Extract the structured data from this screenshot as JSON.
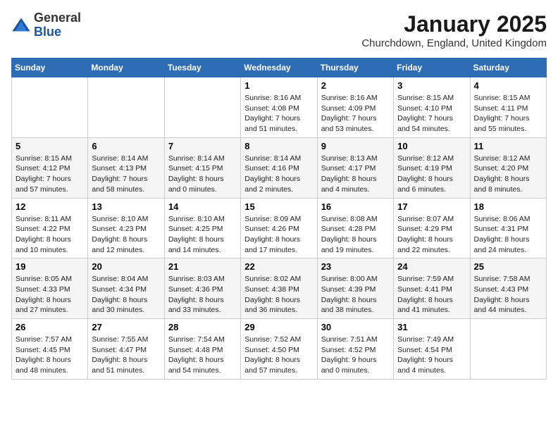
{
  "logo": {
    "general": "General",
    "blue": "Blue"
  },
  "header": {
    "month": "January 2025",
    "location": "Churchdown, England, United Kingdom"
  },
  "days_of_week": [
    "Sunday",
    "Monday",
    "Tuesday",
    "Wednesday",
    "Thursday",
    "Friday",
    "Saturday"
  ],
  "weeks": [
    [
      {
        "day": "",
        "info": ""
      },
      {
        "day": "",
        "info": ""
      },
      {
        "day": "",
        "info": ""
      },
      {
        "day": "1",
        "info": "Sunrise: 8:16 AM\nSunset: 4:08 PM\nDaylight: 7 hours\nand 51 minutes."
      },
      {
        "day": "2",
        "info": "Sunrise: 8:16 AM\nSunset: 4:09 PM\nDaylight: 7 hours\nand 53 minutes."
      },
      {
        "day": "3",
        "info": "Sunrise: 8:15 AM\nSunset: 4:10 PM\nDaylight: 7 hours\nand 54 minutes."
      },
      {
        "day": "4",
        "info": "Sunrise: 8:15 AM\nSunset: 4:11 PM\nDaylight: 7 hours\nand 55 minutes."
      }
    ],
    [
      {
        "day": "5",
        "info": "Sunrise: 8:15 AM\nSunset: 4:12 PM\nDaylight: 7 hours\nand 57 minutes."
      },
      {
        "day": "6",
        "info": "Sunrise: 8:14 AM\nSunset: 4:13 PM\nDaylight: 7 hours\nand 58 minutes."
      },
      {
        "day": "7",
        "info": "Sunrise: 8:14 AM\nSunset: 4:15 PM\nDaylight: 8 hours\nand 0 minutes."
      },
      {
        "day": "8",
        "info": "Sunrise: 8:14 AM\nSunset: 4:16 PM\nDaylight: 8 hours\nand 2 minutes."
      },
      {
        "day": "9",
        "info": "Sunrise: 8:13 AM\nSunset: 4:17 PM\nDaylight: 8 hours\nand 4 minutes."
      },
      {
        "day": "10",
        "info": "Sunrise: 8:12 AM\nSunset: 4:19 PM\nDaylight: 8 hours\nand 6 minutes."
      },
      {
        "day": "11",
        "info": "Sunrise: 8:12 AM\nSunset: 4:20 PM\nDaylight: 8 hours\nand 8 minutes."
      }
    ],
    [
      {
        "day": "12",
        "info": "Sunrise: 8:11 AM\nSunset: 4:22 PM\nDaylight: 8 hours\nand 10 minutes."
      },
      {
        "day": "13",
        "info": "Sunrise: 8:10 AM\nSunset: 4:23 PM\nDaylight: 8 hours\nand 12 minutes."
      },
      {
        "day": "14",
        "info": "Sunrise: 8:10 AM\nSunset: 4:25 PM\nDaylight: 8 hours\nand 14 minutes."
      },
      {
        "day": "15",
        "info": "Sunrise: 8:09 AM\nSunset: 4:26 PM\nDaylight: 8 hours\nand 17 minutes."
      },
      {
        "day": "16",
        "info": "Sunrise: 8:08 AM\nSunset: 4:28 PM\nDaylight: 8 hours\nand 19 minutes."
      },
      {
        "day": "17",
        "info": "Sunrise: 8:07 AM\nSunset: 4:29 PM\nDaylight: 8 hours\nand 22 minutes."
      },
      {
        "day": "18",
        "info": "Sunrise: 8:06 AM\nSunset: 4:31 PM\nDaylight: 8 hours\nand 24 minutes."
      }
    ],
    [
      {
        "day": "19",
        "info": "Sunrise: 8:05 AM\nSunset: 4:33 PM\nDaylight: 8 hours\nand 27 minutes."
      },
      {
        "day": "20",
        "info": "Sunrise: 8:04 AM\nSunset: 4:34 PM\nDaylight: 8 hours\nand 30 minutes."
      },
      {
        "day": "21",
        "info": "Sunrise: 8:03 AM\nSunset: 4:36 PM\nDaylight: 8 hours\nand 33 minutes."
      },
      {
        "day": "22",
        "info": "Sunrise: 8:02 AM\nSunset: 4:38 PM\nDaylight: 8 hours\nand 36 minutes."
      },
      {
        "day": "23",
        "info": "Sunrise: 8:00 AM\nSunset: 4:39 PM\nDaylight: 8 hours\nand 38 minutes."
      },
      {
        "day": "24",
        "info": "Sunrise: 7:59 AM\nSunset: 4:41 PM\nDaylight: 8 hours\nand 41 minutes."
      },
      {
        "day": "25",
        "info": "Sunrise: 7:58 AM\nSunset: 4:43 PM\nDaylight: 8 hours\nand 44 minutes."
      }
    ],
    [
      {
        "day": "26",
        "info": "Sunrise: 7:57 AM\nSunset: 4:45 PM\nDaylight: 8 hours\nand 48 minutes."
      },
      {
        "day": "27",
        "info": "Sunrise: 7:55 AM\nSunset: 4:47 PM\nDaylight: 8 hours\nand 51 minutes."
      },
      {
        "day": "28",
        "info": "Sunrise: 7:54 AM\nSunset: 4:48 PM\nDaylight: 8 hours\nand 54 minutes."
      },
      {
        "day": "29",
        "info": "Sunrise: 7:52 AM\nSunset: 4:50 PM\nDaylight: 8 hours\nand 57 minutes."
      },
      {
        "day": "30",
        "info": "Sunrise: 7:51 AM\nSunset: 4:52 PM\nDaylight: 9 hours\nand 0 minutes."
      },
      {
        "day": "31",
        "info": "Sunrise: 7:49 AM\nSunset: 4:54 PM\nDaylight: 9 hours\nand 4 minutes."
      },
      {
        "day": "",
        "info": ""
      }
    ]
  ]
}
